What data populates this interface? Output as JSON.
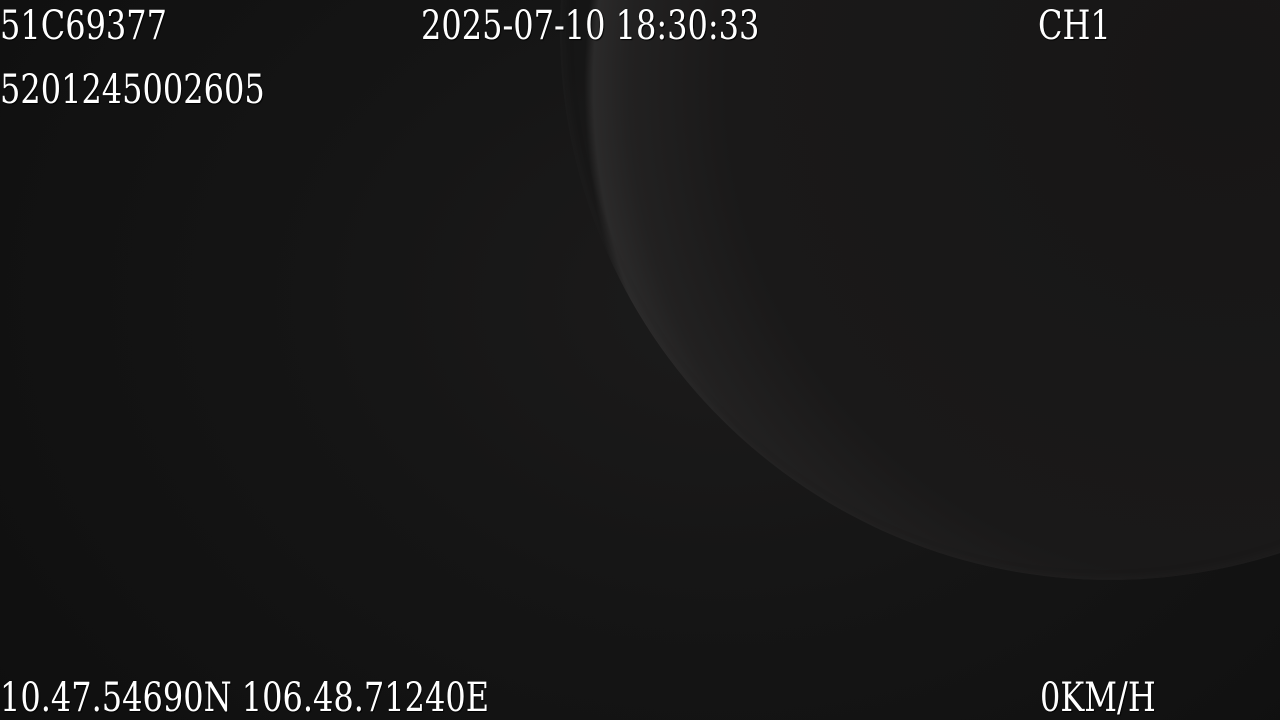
{
  "osd": {
    "plate": "51C69377",
    "datetime": "2025-07-10 18:30:33",
    "channel": "CH1",
    "device_id": "5201245002605",
    "coordinates": "10.47.54690N 106.48.71240E",
    "speed": "0KM/H"
  },
  "colors": {
    "overlay_text": "#ffffff",
    "background": "#121212"
  }
}
